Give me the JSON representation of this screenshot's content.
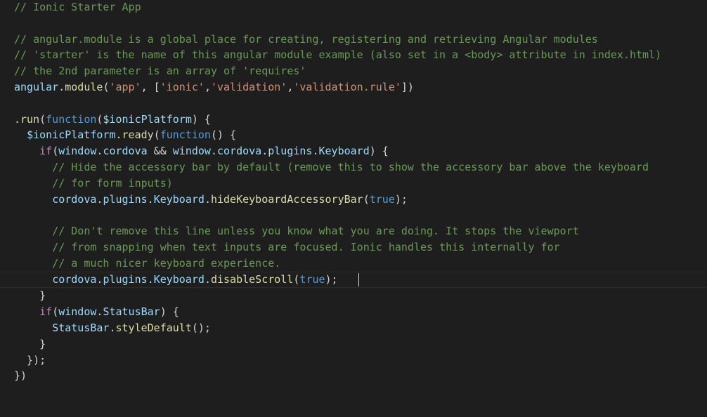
{
  "editor": {
    "lines": [
      [
        {
          "c": "comment",
          "t": "// Ionic Starter App"
        }
      ],
      [],
      [
        {
          "c": "comment",
          "t": "// angular.module is a global place for creating, registering and retrieving Angular modules"
        }
      ],
      [
        {
          "c": "comment",
          "t": "// 'starter' is the name of this angular module example (also set in a <body> attribute in index.html)"
        }
      ],
      [
        {
          "c": "comment",
          "t": "// the 2nd parameter is an array of 'requires'"
        }
      ],
      [
        {
          "c": "ident",
          "t": "angular"
        },
        {
          "c": "plain",
          "t": "."
        },
        {
          "c": "func",
          "t": "module"
        },
        {
          "c": "plain",
          "t": "("
        },
        {
          "c": "string",
          "t": "'app'"
        },
        {
          "c": "plain",
          "t": ", ["
        },
        {
          "c": "string",
          "t": "'ionic'"
        },
        {
          "c": "plain",
          "t": ","
        },
        {
          "c": "string",
          "t": "'validation'"
        },
        {
          "c": "plain",
          "t": ","
        },
        {
          "c": "string",
          "t": "'validation.rule'"
        },
        {
          "c": "plain",
          "t": "])"
        }
      ],
      [],
      [
        {
          "c": "plain",
          "t": "."
        },
        {
          "c": "func",
          "t": "run"
        },
        {
          "c": "plain",
          "t": "("
        },
        {
          "c": "keyword",
          "t": "function"
        },
        {
          "c": "plain",
          "t": "("
        },
        {
          "c": "ident",
          "t": "$ionicPlatform"
        },
        {
          "c": "plain",
          "t": ") {"
        }
      ],
      [
        {
          "c": "plain",
          "t": "  "
        },
        {
          "c": "ident",
          "t": "$ionicPlatform"
        },
        {
          "c": "plain",
          "t": "."
        },
        {
          "c": "func",
          "t": "ready"
        },
        {
          "c": "plain",
          "t": "("
        },
        {
          "c": "keyword",
          "t": "function"
        },
        {
          "c": "plain",
          "t": "() {"
        }
      ],
      [
        {
          "c": "plain",
          "t": "    "
        },
        {
          "c": "control",
          "t": "if"
        },
        {
          "c": "plain",
          "t": "("
        },
        {
          "c": "ident",
          "t": "window"
        },
        {
          "c": "plain",
          "t": "."
        },
        {
          "c": "ident",
          "t": "cordova"
        },
        {
          "c": "plain",
          "t": " && "
        },
        {
          "c": "ident",
          "t": "window"
        },
        {
          "c": "plain",
          "t": "."
        },
        {
          "c": "ident",
          "t": "cordova"
        },
        {
          "c": "plain",
          "t": "."
        },
        {
          "c": "ident",
          "t": "plugins"
        },
        {
          "c": "plain",
          "t": "."
        },
        {
          "c": "ident",
          "t": "Keyboard"
        },
        {
          "c": "plain",
          "t": ") {"
        }
      ],
      [
        {
          "c": "plain",
          "t": "      "
        },
        {
          "c": "comment",
          "t": "// Hide the accessory bar by default (remove this to show the accessory bar above the keyboard"
        }
      ],
      [
        {
          "c": "plain",
          "t": "      "
        },
        {
          "c": "comment",
          "t": "// for form inputs)"
        }
      ],
      [
        {
          "c": "plain",
          "t": "      "
        },
        {
          "c": "ident",
          "t": "cordova"
        },
        {
          "c": "plain",
          "t": "."
        },
        {
          "c": "ident",
          "t": "plugins"
        },
        {
          "c": "plain",
          "t": "."
        },
        {
          "c": "ident",
          "t": "Keyboard"
        },
        {
          "c": "plain",
          "t": "."
        },
        {
          "c": "func",
          "t": "hideKeyboardAccessoryBar"
        },
        {
          "c": "plain",
          "t": "("
        },
        {
          "c": "keyword",
          "t": "true"
        },
        {
          "c": "plain",
          "t": ");"
        }
      ],
      [],
      [
        {
          "c": "plain",
          "t": "      "
        },
        {
          "c": "comment",
          "t": "// Don't remove this line unless you know what you are doing. It stops the viewport"
        }
      ],
      [
        {
          "c": "plain",
          "t": "      "
        },
        {
          "c": "comment",
          "t": "// from snapping when text inputs are focused. Ionic handles this internally for"
        }
      ],
      [
        {
          "c": "plain",
          "t": "      "
        },
        {
          "c": "comment",
          "t": "// a much nicer keyboard experience."
        }
      ],
      [
        {
          "c": "plain",
          "t": "      "
        },
        {
          "c": "ident",
          "t": "cordova"
        },
        {
          "c": "plain",
          "t": "."
        },
        {
          "c": "ident",
          "t": "plugins"
        },
        {
          "c": "plain",
          "t": "."
        },
        {
          "c": "ident",
          "t": "Keyboard"
        },
        {
          "c": "plain",
          "t": "."
        },
        {
          "c": "func",
          "t": "disableScroll"
        },
        {
          "c": "plain",
          "t": "("
        },
        {
          "c": "keyword",
          "t": "true"
        },
        {
          "c": "plain",
          "t": ");   "
        }
      ],
      [
        {
          "c": "plain",
          "t": "    }"
        }
      ],
      [
        {
          "c": "plain",
          "t": "    "
        },
        {
          "c": "control",
          "t": "if"
        },
        {
          "c": "plain",
          "t": "("
        },
        {
          "c": "ident",
          "t": "window"
        },
        {
          "c": "plain",
          "t": "."
        },
        {
          "c": "ident",
          "t": "StatusBar"
        },
        {
          "c": "plain",
          "t": ") {"
        }
      ],
      [
        {
          "c": "plain",
          "t": "      "
        },
        {
          "c": "ident",
          "t": "StatusBar"
        },
        {
          "c": "plain",
          "t": "."
        },
        {
          "c": "func",
          "t": "styleDefault"
        },
        {
          "c": "plain",
          "t": "();"
        }
      ],
      [
        {
          "c": "plain",
          "t": "    }"
        }
      ],
      [
        {
          "c": "plain",
          "t": "  });"
        }
      ],
      [
        {
          "c": "plain",
          "t": "})"
        }
      ]
    ],
    "cursor_line": 18,
    "colors": {
      "background": "#1e1e1e",
      "comment": "#6a9955",
      "identifier": "#9cdcfe",
      "function": "#dcdcaa",
      "string": "#ce9178",
      "keyword": "#569cd6",
      "control": "#c586c0",
      "plain": "#d4d4d4"
    }
  }
}
